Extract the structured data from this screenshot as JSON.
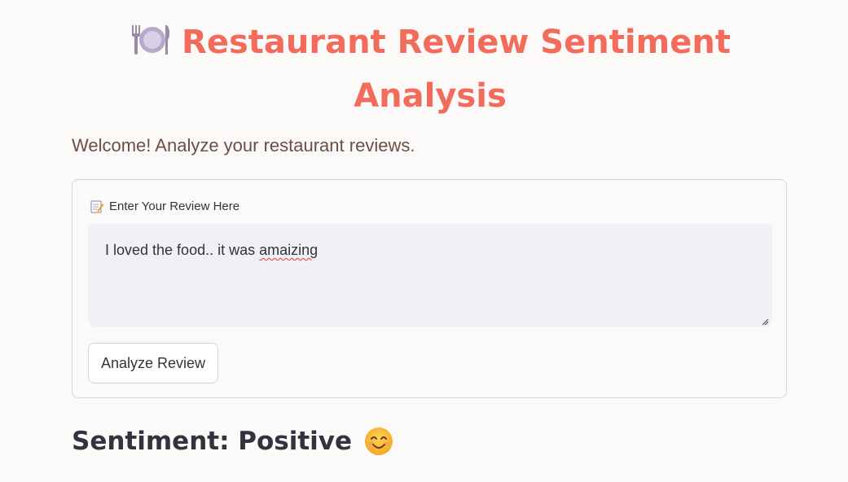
{
  "header": {
    "title": "Restaurant Review Sentiment Analysis",
    "title_icon": "fork-plate-knife-icon",
    "welcome": "Welcome! Analyze your restaurant reviews."
  },
  "form": {
    "label": "Enter Your Review Here",
    "label_icon": "memo-icon",
    "review_text_before": "I loved the food.. it was ",
    "review_text_misspelled": "amaizing",
    "button_label": "Analyze Review"
  },
  "result": {
    "sentiment_text": "Sentiment: Positive",
    "sentiment_icon": "smiling-face-icon"
  },
  "colors": {
    "accent": "#f26b5b",
    "text": "#31333f",
    "welcome_text": "#6b4f45",
    "input_background": "#f0f1f5",
    "page_background": "#fcfaf8"
  }
}
